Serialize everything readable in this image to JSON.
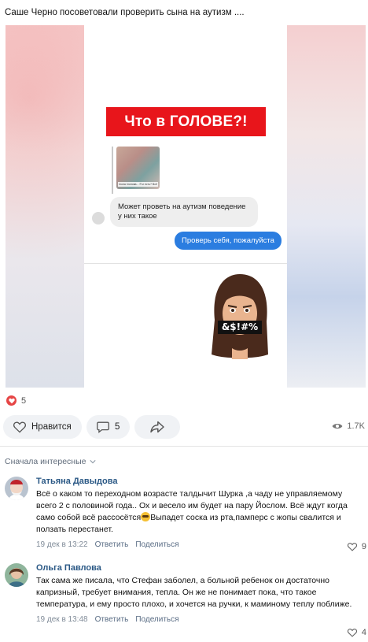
{
  "post": {
    "text": "Саше Черно посоветовали проверить сына на аутизм ....",
    "image": {
      "headline": "Что в ГОЛОВЕ?!",
      "thumb_caption": "Ілона Ілонова... Я и есть? Всё",
      "incoming_message": "Может проветь на аутизм поведение у них такое",
      "outgoing_message": "Проверь себя, пожалуйста",
      "memoji_mask_text": "&$!#%",
      "colors": {
        "headline_bg": "#e8151b",
        "outgoing_bubble": "#2b7de0",
        "incoming_bubble": "#eeeeee"
      }
    },
    "reactions_count": "5",
    "actions": {
      "like_label": "Нравится",
      "comments_count": "5",
      "views": "1.7K"
    }
  },
  "comments": {
    "sort_label": "Сначала интересные",
    "items": [
      {
        "author": "Татьяна Давыдова",
        "text_before_emoji": "Всё о каком то переходном возрасте талдычит Шурка ,а чаду не управляемому всего 2 с половиной года.. Ох и весело им будет на пару Йослом. Всё ждут когда само собой всё рассосётся",
        "text_after_emoji": "Выпадет соска из рта,памперс с жопы свалится и ползать перестанет.",
        "timestamp": "19 дек в 13:22",
        "reply_label": "Ответить",
        "share_label": "Поделиться",
        "likes": "9"
      },
      {
        "author": "Ольга Павлова",
        "text": "Так сама же писала, что Стефан заболел, а больной ребенок он достаточно капризный, требует внимания, тепла. Он же не понимает пока, что такое температура, и ему просто плохо, и хочется на ручки, к маминому теплу поближе.",
        "timestamp": "19 дек в 13:48",
        "reply_label": "Ответить",
        "share_label": "Поделиться",
        "likes": "4"
      }
    ]
  },
  "colors": {
    "link": "#2a5885",
    "meta": "#818c99",
    "reaction": "#e64646"
  }
}
